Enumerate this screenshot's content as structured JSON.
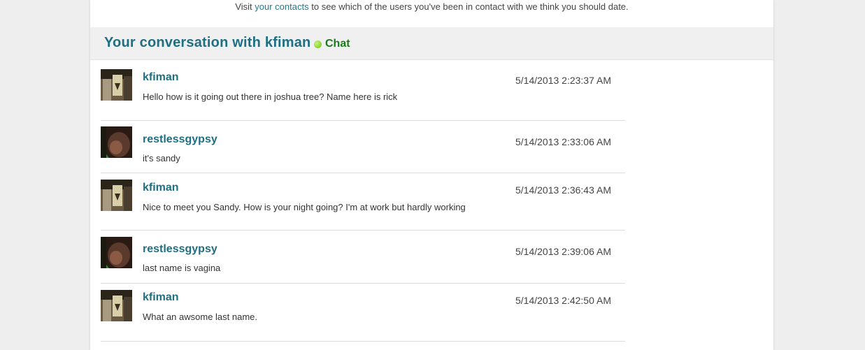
{
  "visit": {
    "prefix": "Visit",
    "link": "your contacts",
    "suffix": "to see which of the users you've been in contact with we think you should date."
  },
  "conversation": {
    "title": "Your conversation with kfiman",
    "chat_label": "Chat",
    "chat_status_color": "#6fc21a"
  },
  "messages": [
    {
      "user": "kfiman",
      "time": "5/14/2013 2:23:37 AM",
      "text": "Hello how is it going out there in joshua tree? Name here is rick"
    },
    {
      "user": "restlessgypsy",
      "time": "5/14/2013 2:33:06 AM",
      "text": "it's sandy"
    },
    {
      "user": "kfiman",
      "time": "5/14/2013 2:36:43 AM",
      "text": "Nice to meet you Sandy. How is your night going? I'm at work but hardly working"
    },
    {
      "user": "restlessgypsy",
      "time": "5/14/2013 2:39:06 AM",
      "text": "last name is vagina"
    },
    {
      "user": "kfiman",
      "time": "5/14/2013 2:42:50 AM",
      "text": "What an awsome last name."
    }
  ],
  "colors": {
    "accent": "#1f6f82",
    "link": "#1f7a8c",
    "chat_text": "#1b7a1b"
  }
}
